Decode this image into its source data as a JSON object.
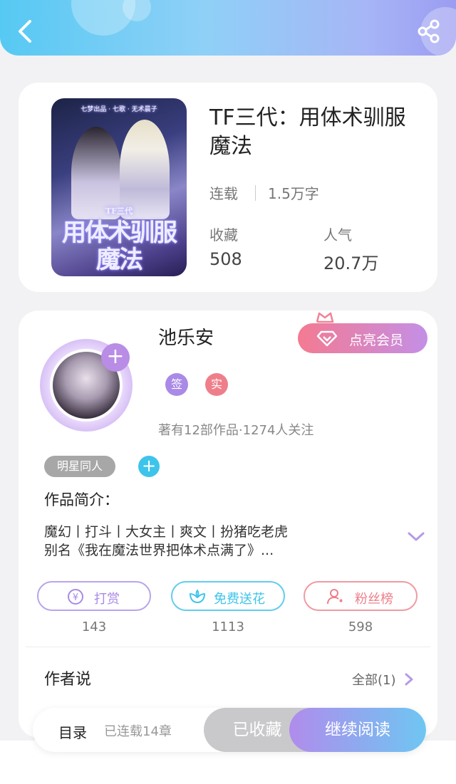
{
  "book": {
    "title": "TF三代：用体术驯服魔法",
    "status": "连载",
    "word_count": "1.5万字",
    "favorites_label": "收藏",
    "favorites_value": "508",
    "popularity_label": "人气",
    "popularity_value": "20.7万",
    "cover_title": "用体术驯服魔法",
    "cover_small": "TF三代",
    "cover_credits": "七梦出品 · 七歌 · 无术晨子"
  },
  "author": {
    "name": "池乐安",
    "vip_label": "点亮会员",
    "badge_sign": "签",
    "badge_real": "实",
    "works_info": "著有12部作品·1274人关注",
    "genre_tag": "明星同人",
    "intro_heading": "作品简介：",
    "intro_line1": "魔幻丨打斗丨大女主丨爽文丨扮猪吃老虎",
    "intro_line2": "别名《我在魔法世界把体术点满了》..."
  },
  "actions": [
    {
      "label": "打赏",
      "count": "143"
    },
    {
      "label": "免费送花",
      "count": "1113"
    },
    {
      "label": "粉丝榜",
      "count": "598"
    }
  ],
  "author_says": {
    "heading": "作者说",
    "all": "全部(1)"
  },
  "bottom": {
    "toc": "目录",
    "chapters": "已连载14章",
    "favorited": "已收藏",
    "continue": "继续阅读"
  },
  "colors": {
    "header_start": "#56c9f3",
    "header_end": "#9c9cf1",
    "reward": "#a98ae6",
    "flower": "#3ec4ea",
    "fans": "#ee7f8a",
    "vip_start": "#f47a92",
    "vip_end": "#c48fe6"
  },
  "icons": [
    "back-arrow-icon",
    "share-icon",
    "diamond-icon",
    "crown-icon",
    "yen-icon",
    "flower-icon",
    "fans-icon",
    "chevron-down-icon",
    "chevron-right-icon"
  ]
}
